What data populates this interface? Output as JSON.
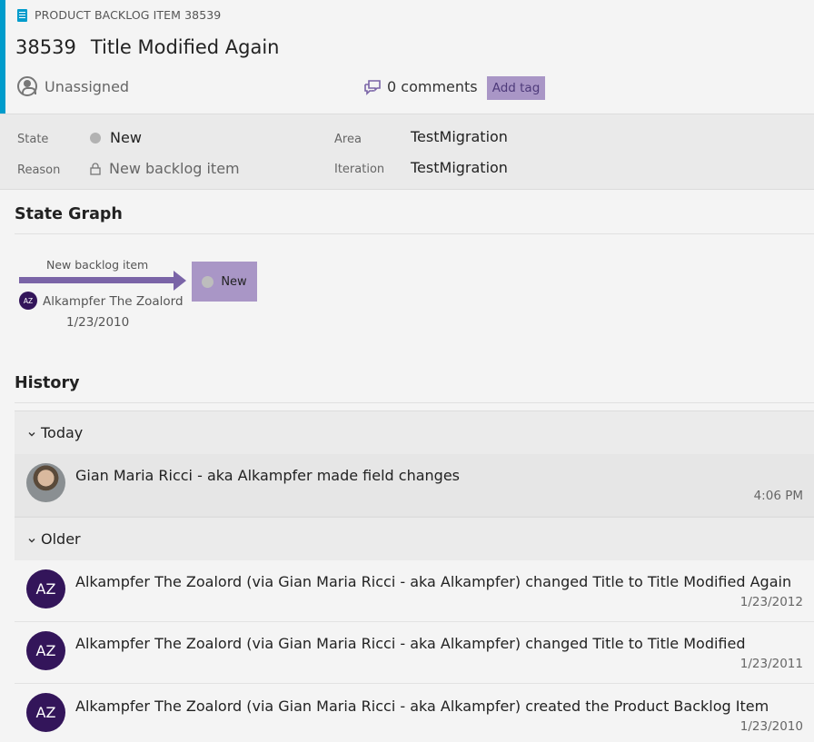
{
  "header": {
    "type_label": "PRODUCT BACKLOG ITEM 38539",
    "id": "38539",
    "title": "Title Modified Again",
    "assigned": "Unassigned",
    "comments": "0 comments",
    "add_tag": "Add tag"
  },
  "fields": {
    "state_label": "State",
    "state_value": "New",
    "reason_label": "Reason",
    "reason_value": "New backlog item",
    "area_label": "Area",
    "area_value": "TestMigration",
    "iteration_label": "Iteration",
    "iteration_value": "TestMigration"
  },
  "state_graph": {
    "title": "State Graph",
    "transition_label": "New backlog item",
    "user_initials": "AZ",
    "user": "Alkampfer The Zoalord",
    "date": "1/23/2010",
    "state": "New"
  },
  "history": {
    "title": "History",
    "groups": [
      {
        "label": "Today",
        "items": [
          {
            "initials": "",
            "text": "Gian Maria Ricci - aka Alkampfer made field changes",
            "time": "4:06 PM"
          }
        ]
      },
      {
        "label": "Older",
        "items": [
          {
            "initials": "AZ",
            "text": "Alkampfer The Zoalord (via Gian Maria Ricci - aka Alkampfer) changed Title to Title Modified Again",
            "time": "1/23/2012"
          },
          {
            "initials": "AZ",
            "text": "Alkampfer The Zoalord (via Gian Maria Ricci - aka Alkampfer) changed Title to Title Modified",
            "time": "1/23/2011"
          },
          {
            "initials": "AZ",
            "text": "Alkampfer The Zoalord (via Gian Maria Ricci - aka Alkampfer) created the Product Backlog Item",
            "time": "1/23/2010"
          }
        ]
      }
    ]
  },
  "colors": {
    "accent": "#009ccc",
    "state_purple": "#7a64a7",
    "tag_purple": "#a996c6",
    "avatar_dark": "#33155a"
  }
}
